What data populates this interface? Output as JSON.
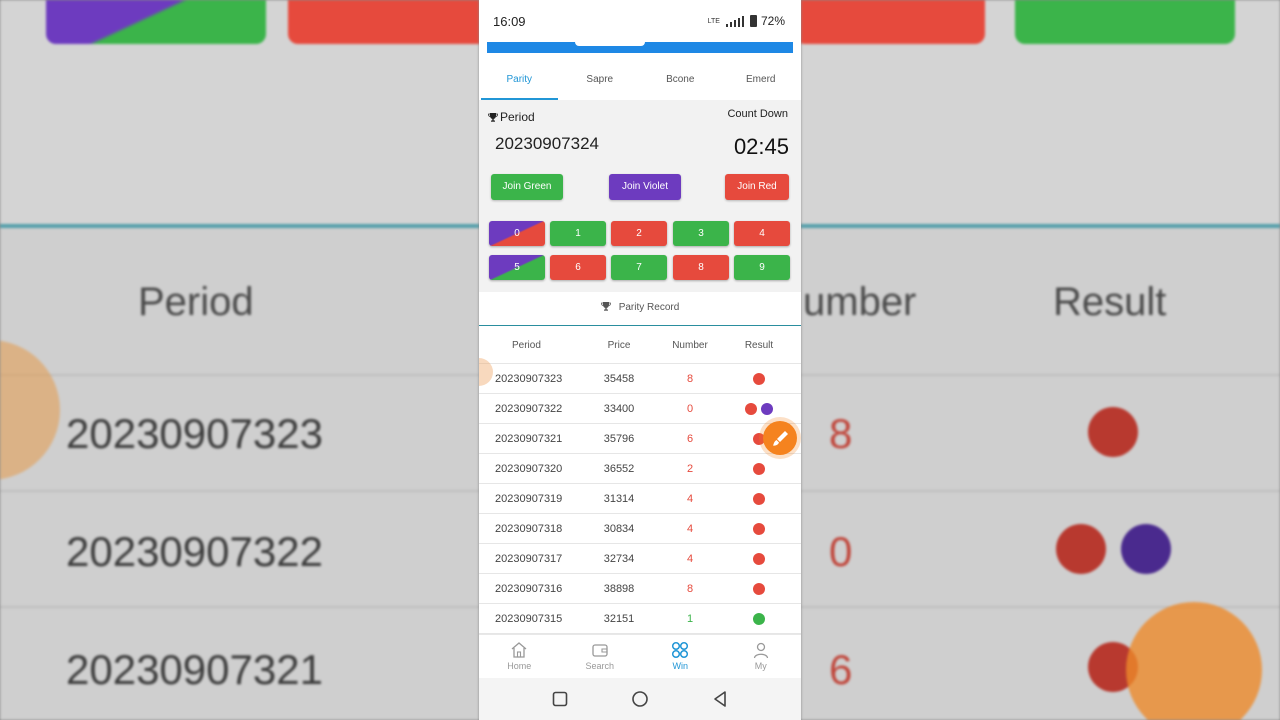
{
  "status_bar": {
    "time": "16:09",
    "battery": "72%",
    "signal_text": "LTE"
  },
  "tabs": [
    {
      "label": "Parity",
      "active": true
    },
    {
      "label": "Sapre",
      "active": false
    },
    {
      "label": "Bcone",
      "active": false
    },
    {
      "label": "Emerd",
      "active": false
    }
  ],
  "period": {
    "label": "Period",
    "value": "20230907324"
  },
  "countdown": {
    "label": "Count Down",
    "value": "02:45"
  },
  "join_buttons": {
    "green": "Join Green",
    "violet": "Join Violet",
    "red": "Join Red"
  },
  "numbers": [
    "0",
    "1",
    "2",
    "3",
    "4",
    "5",
    "6",
    "7",
    "8",
    "9"
  ],
  "record_title": "Parity Record",
  "table_headers": {
    "period": "Period",
    "price": "Price",
    "number": "Number",
    "result": "Result"
  },
  "records": [
    {
      "period": "20230907323",
      "price": "35458",
      "number": "8"
    },
    {
      "period": "20230907322",
      "price": "33400",
      "number": "0"
    },
    {
      "period": "20230907321",
      "price": "35796",
      "number": "6"
    },
    {
      "period": "20230907320",
      "price": "36552",
      "number": "2"
    },
    {
      "period": "20230907319",
      "price": "31314",
      "number": "4"
    },
    {
      "period": "20230907318",
      "price": "30834",
      "number": "4"
    },
    {
      "period": "20230907317",
      "price": "32734",
      "number": "4"
    },
    {
      "period": "20230907316",
      "price": "38898",
      "number": "8"
    },
    {
      "period": "20230907315",
      "price": "32151",
      "number": "1"
    }
  ],
  "bottom_nav": [
    {
      "label": "Home",
      "active": false
    },
    {
      "label": "Search",
      "active": false
    },
    {
      "label": "Win",
      "active": true
    },
    {
      "label": "My",
      "active": false
    }
  ],
  "colors": {
    "green": "#3bb44a",
    "red": "#e64a3d",
    "violet": "#6d3bbf",
    "accent": "#2196d6",
    "fab": "#f5831f"
  },
  "background_zoom": {
    "headers": {
      "period": "Period",
      "number": "umber",
      "result": "Result"
    },
    "periods": [
      "20230907323",
      "20230907322",
      "20230907321"
    ],
    "numbers": [
      "8",
      "0",
      "6"
    ]
  }
}
